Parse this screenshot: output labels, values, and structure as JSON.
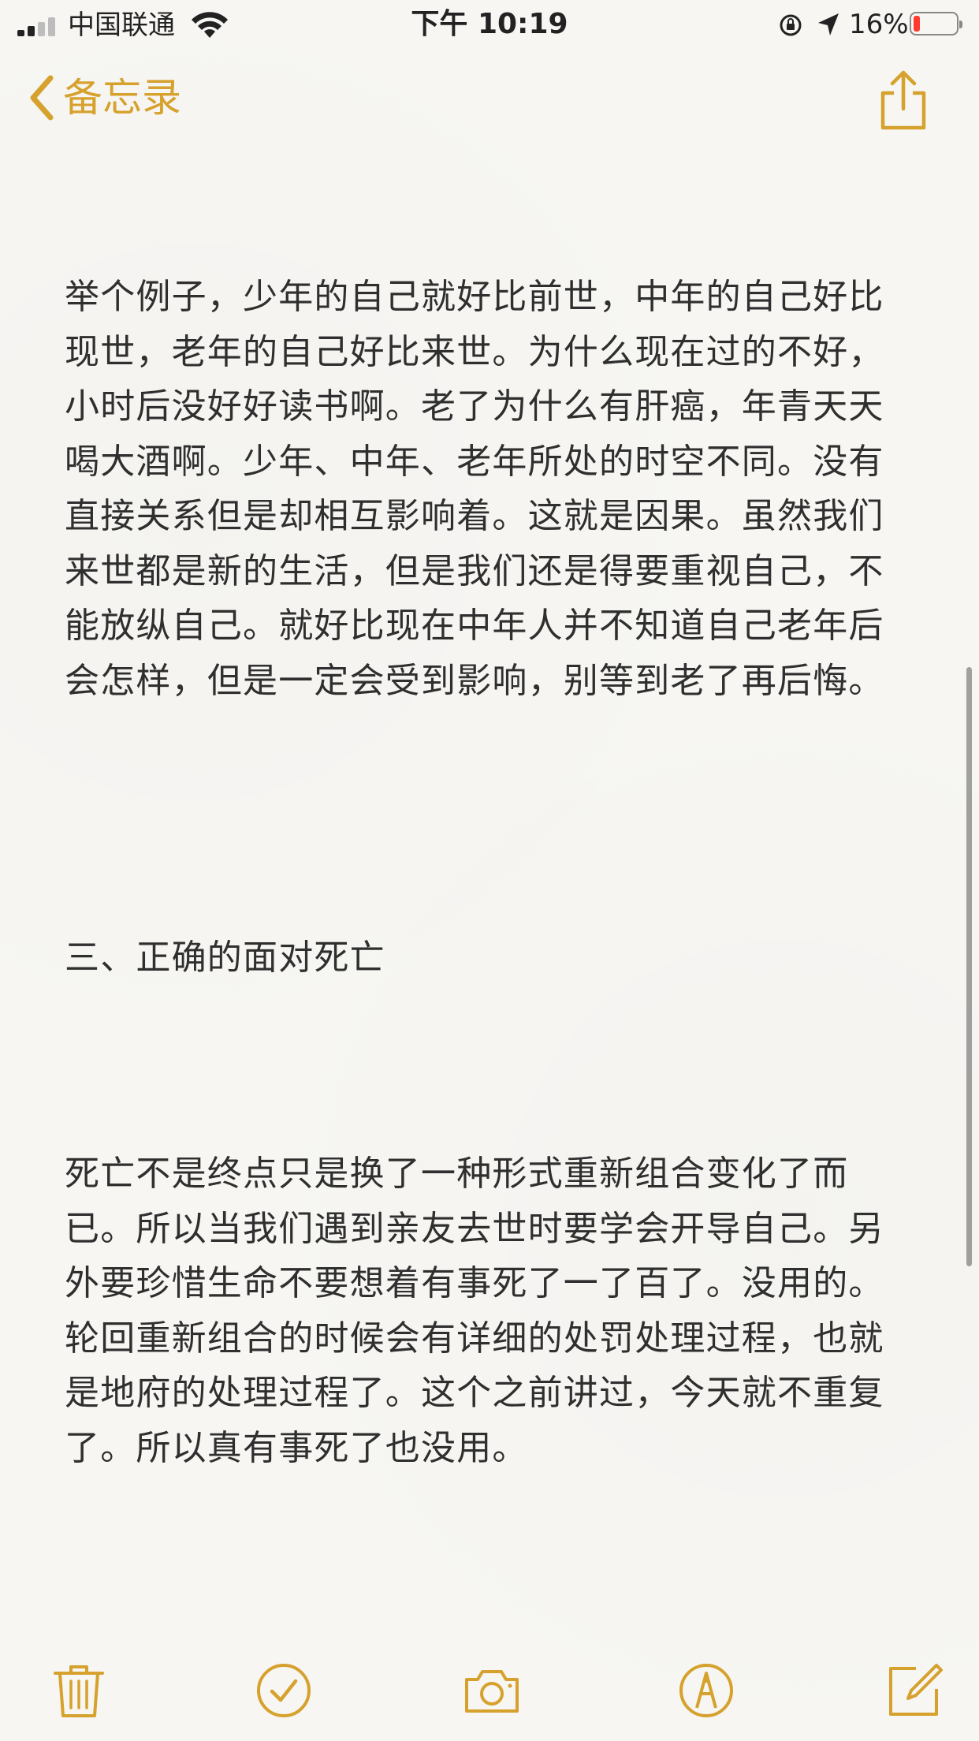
{
  "status_bar": {
    "carrier": "中国联通",
    "time": "下午 10:19",
    "battery_percent": "16%",
    "battery_level": 0.16,
    "signal_bars": 2,
    "signal_bars_total": 4,
    "icons": [
      "signal-icon",
      "wifi-icon",
      "orientation-lock-icon",
      "location-arrow-icon",
      "battery-icon"
    ]
  },
  "nav": {
    "back_label": "备忘录",
    "accent_color": "#d6a12d",
    "icons": [
      "chevron-left-icon",
      "share-icon"
    ]
  },
  "note": {
    "paragraph_1": "举个例子，少年的自己就好比前世，中年的自己好比现世，老年的自己好比来世。为什么现在过的不好，小时后没好好读书啊。老了为什么有肝癌，年青天天喝大酒啊。少年、中年、老年所处的时空不同。没有直接关系但是却相互影响着。这就是因果。虽然我们来世都是新的生活，但是我们还是得要重视自己，不能放纵自己。就好比现在中年人并不知道自己老年后会怎样，但是一定会受到影响，别等到老了再后悔。",
    "heading": "三、正确的面对死亡",
    "paragraph_2": "死亡不是终点只是换了一种形式重新组合变化了而已。所以当我们遇到亲友去世时要学会开导自己。另外要珍惜生命不要想着有事死了一了百了。没用的。轮回重新组合的时候会有详细的处罚处理过程，也就是地府的处理过程了。这个之前讲过，今天就不重复了。所以真有事死了也没用。"
  },
  "toolbar": {
    "icons": [
      "trash-icon",
      "checklist-icon",
      "camera-icon",
      "markup-icon",
      "compose-icon"
    ]
  }
}
